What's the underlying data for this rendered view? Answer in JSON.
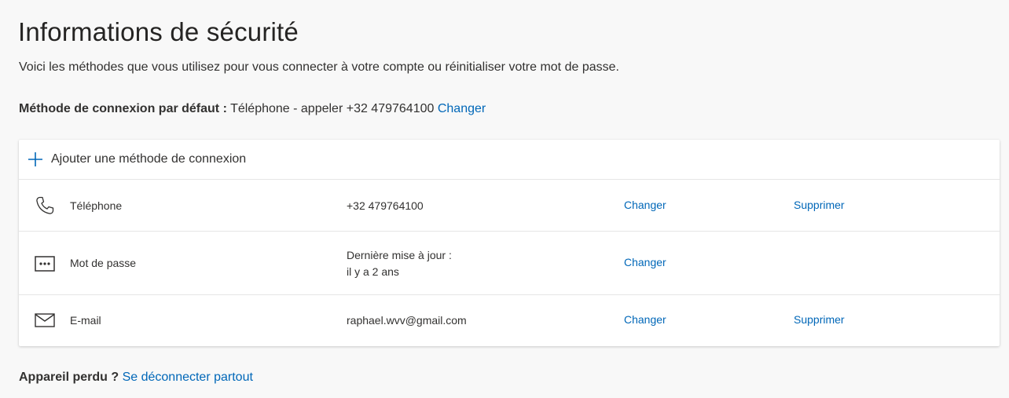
{
  "page": {
    "title": "Informations de sécurité",
    "subtitle": "Voici les méthodes que vous utilisez pour vous connecter à votre compte ou réinitialiser votre mot de passe.",
    "default_method": {
      "label": "Méthode de connexion par défaut :",
      "value": "Téléphone - appeler +32 479764100",
      "change_link": "Changer"
    },
    "add_method_label": "Ajouter une méthode de connexion",
    "methods": [
      {
        "icon": "phone-icon",
        "name": "Téléphone",
        "value": "+32 479764100",
        "change": "Changer",
        "delete": "Supprimer"
      },
      {
        "icon": "password-icon",
        "name": "Mot de passe",
        "value_line1": "Dernière mise à jour :",
        "value_line2": "il y a 2 ans",
        "change": "Changer"
      },
      {
        "icon": "mail-icon",
        "name": "E-mail",
        "value": "raphael.wvv@gmail.com",
        "change": "Changer",
        "delete": "Supprimer"
      }
    ],
    "lost_device": {
      "label": "Appareil perdu ?",
      "link": "Se déconnecter partout"
    }
  },
  "colors": {
    "link": "#0067b8",
    "text": "#323130",
    "background": "#f8f8f8",
    "card": "#ffffff"
  }
}
